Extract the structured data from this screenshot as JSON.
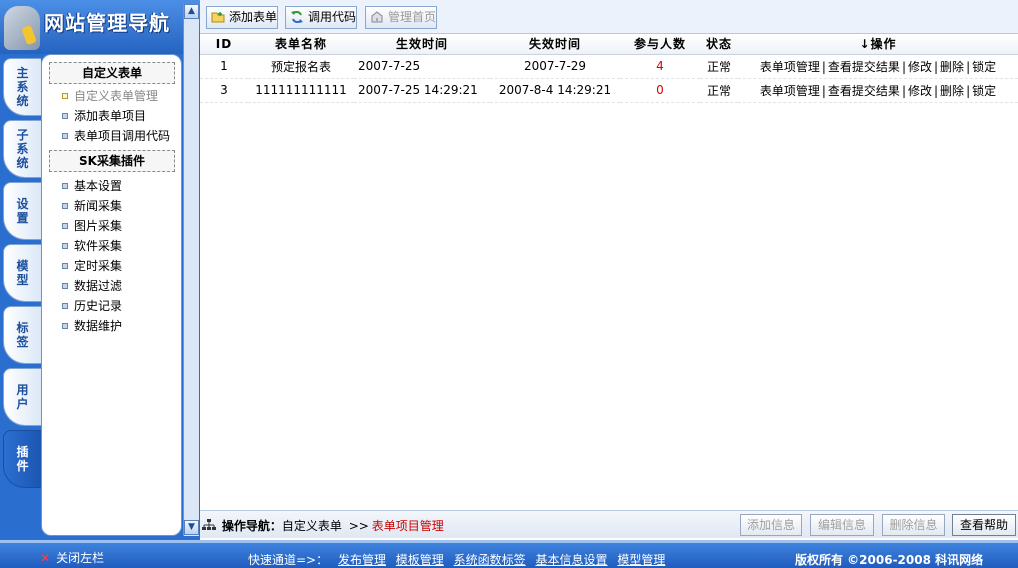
{
  "logo": {
    "title": "网站管理导航"
  },
  "side_tabs": [
    {
      "label": "主系统",
      "active": false
    },
    {
      "label": "子系统",
      "active": false
    },
    {
      "label": "设置",
      "active": false
    },
    {
      "label": "模型",
      "active": false
    },
    {
      "label": "标签",
      "active": false
    },
    {
      "label": "用户",
      "active": false
    },
    {
      "label": "插件",
      "active": true
    }
  ],
  "menu": {
    "section1_title": "自定义表单",
    "section1_items": [
      "自定义表单管理",
      "添加表单项目",
      "表单项目调用代码"
    ],
    "section2_title": "SK采集插件",
    "section2_items": [
      "基本设置",
      "新闻采集",
      "图片采集",
      "软件采集",
      "定时采集",
      "数据过滤",
      "历史记录",
      "数据维护"
    ]
  },
  "toolbar": {
    "add_form": "添加表单",
    "call_code": "调用代码",
    "admin_home": "管理首页"
  },
  "table": {
    "headers": [
      "ID",
      "表单名称",
      "生效时间",
      "失效时间",
      "参与人数",
      "状态",
      "↓操作"
    ],
    "rows": [
      {
        "id": "1",
        "name": "预定报名表",
        "start": "2007-7-25",
        "end": "2007-7-29",
        "count": "4",
        "status": "正常"
      },
      {
        "id": "3",
        "name": "111111111111",
        "start": "2007-7-25 14:29:21",
        "end": "2007-8-4 14:29:21",
        "count": "0",
        "status": "正常"
      }
    ],
    "ops": [
      "表单项管理",
      "查看提交结果",
      "修改",
      "删除",
      "锁定"
    ],
    "op_sep": "|"
  },
  "navbar": {
    "label": "操作导航：",
    "crumb1": "自定义表单",
    "arrow": ">>",
    "crumb2": "表单项目管理",
    "btn_add": "添加信息",
    "btn_edit": "编辑信息",
    "btn_delete": "删除信息",
    "btn_help": "查看帮助"
  },
  "footer": {
    "close_left": "关闭左栏",
    "quick_label": "快速通道=>：",
    "quick_links": [
      "发布管理",
      "模板管理",
      "系统函数标签",
      "基本信息设置",
      "模型管理"
    ],
    "copyright": "版权所有 ©2006-2008 科讯网络"
  },
  "colors": {
    "accent_blue": "#2a6fcf",
    "red_text": "#e00000",
    "crumb_red": "#cc0000"
  }
}
